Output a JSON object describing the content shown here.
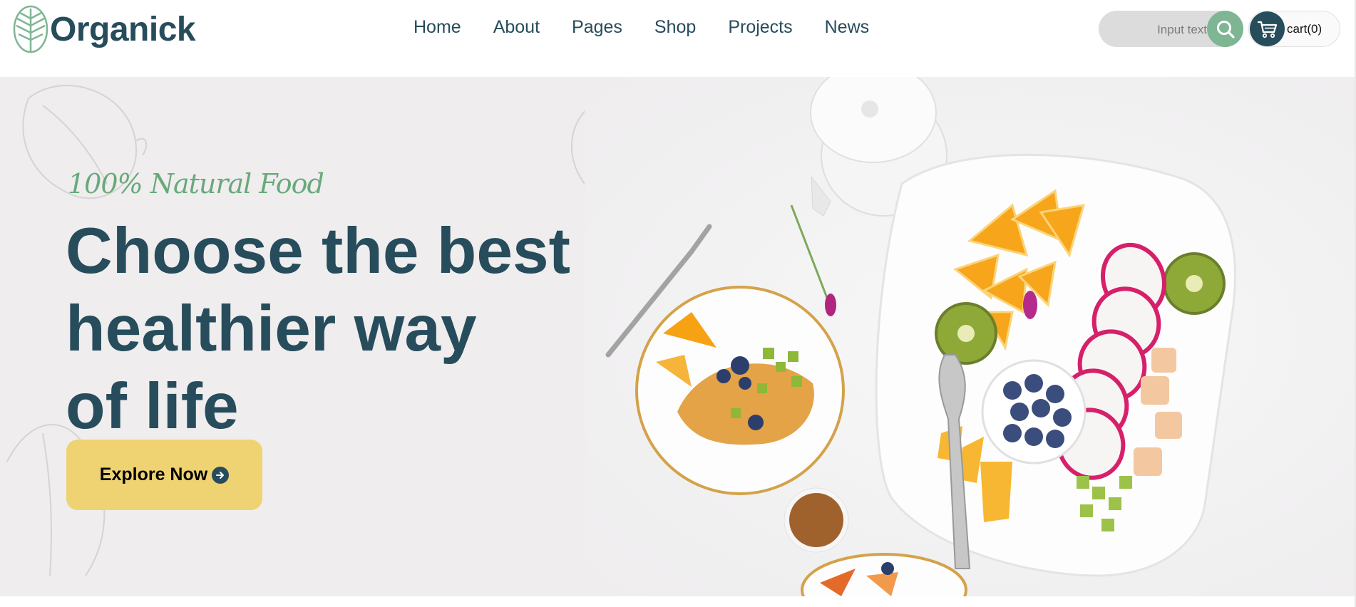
{
  "brand": {
    "name": "Organick",
    "logo_icon": "leaf-logo-icon"
  },
  "nav": {
    "items": [
      {
        "label": "Home"
      },
      {
        "label": "About"
      },
      {
        "label": "Pages"
      },
      {
        "label": "Shop"
      },
      {
        "label": "Projects"
      },
      {
        "label": "News"
      }
    ]
  },
  "search": {
    "placeholder": "Input text",
    "icon": "search-icon"
  },
  "cart": {
    "label": "cart(0)",
    "icon": "cart-icon"
  },
  "hero": {
    "tagline": "100% Natural Food",
    "title_lines": [
      "Choose the best",
      "healthier way",
      "of life"
    ],
    "cta_label": "Explore Now",
    "cta_icon": "arrow-right-icon"
  },
  "colors": {
    "primary": "#274c5b",
    "accent_green": "#7eb693",
    "tagline_green": "#68a97b",
    "cta_yellow": "#efd372",
    "hero_bg": "#efedee"
  }
}
